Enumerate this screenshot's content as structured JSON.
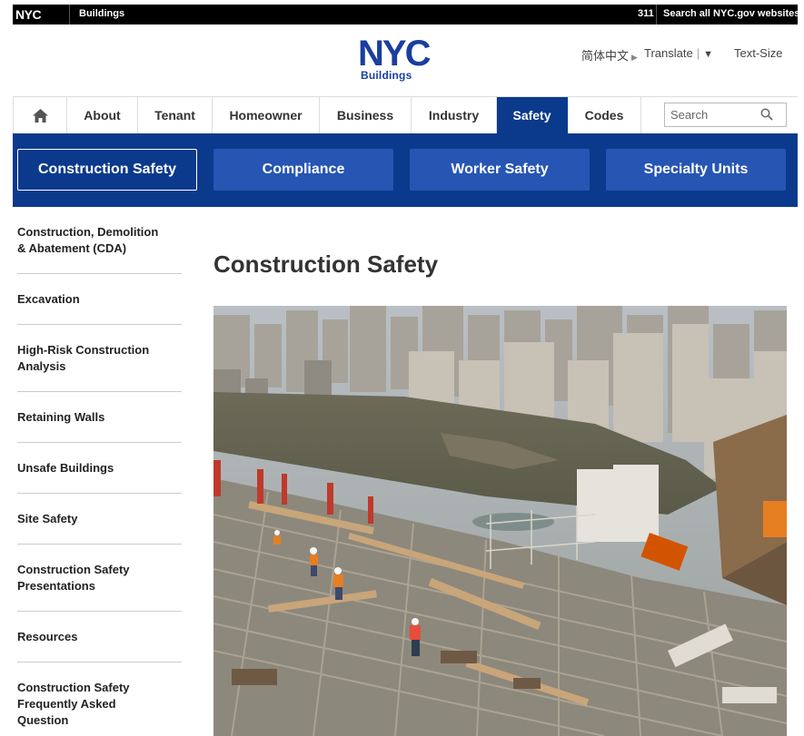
{
  "topbar": {
    "logo": "NYC",
    "agency": "Buildings",
    "phone": "311",
    "search_all": "Search all NYC.gov websites"
  },
  "header": {
    "logo": "NYC",
    "logo_sub": "Buildings",
    "language": "简体中文",
    "translate": "Translate",
    "text_size": "Text-Size"
  },
  "nav": {
    "home_icon": "home-icon",
    "tabs": [
      {
        "label": "About"
      },
      {
        "label": "Tenant"
      },
      {
        "label": "Homeowner"
      },
      {
        "label": "Business"
      },
      {
        "label": "Industry"
      },
      {
        "label": "Safety",
        "active": true
      },
      {
        "label": "Codes"
      }
    ],
    "search_placeholder": "Search"
  },
  "subnav": {
    "buttons": [
      {
        "label": "Construction Safety",
        "active": true
      },
      {
        "label": "Compliance"
      },
      {
        "label": "Worker Safety"
      },
      {
        "label": "Specialty Units"
      }
    ]
  },
  "sidebar": {
    "items": [
      {
        "line1": "Construction, Demolition",
        "line2": "& Abatement (CDA)"
      },
      {
        "line1": "Excavation",
        "line2": ""
      },
      {
        "line1": "High-Risk Construction",
        "line2": "Analysis"
      },
      {
        "line1": "Retaining Walls",
        "line2": ""
      },
      {
        "line1": "Unsafe Buildings",
        "line2": ""
      },
      {
        "line1": "Site Safety",
        "line2": ""
      },
      {
        "line1": "Construction Safety",
        "line2": "Presentations"
      },
      {
        "line1": "Resources",
        "line2": ""
      },
      {
        "line1": "Construction Safety",
        "line2": "Frequently Asked",
        "line3": "Question"
      }
    ]
  },
  "main": {
    "title": "Construction Safety"
  },
  "colors": {
    "nav_blue": "#0b3a8c",
    "button_blue": "#2655b4",
    "brand_blue": "#1a3ea0"
  }
}
